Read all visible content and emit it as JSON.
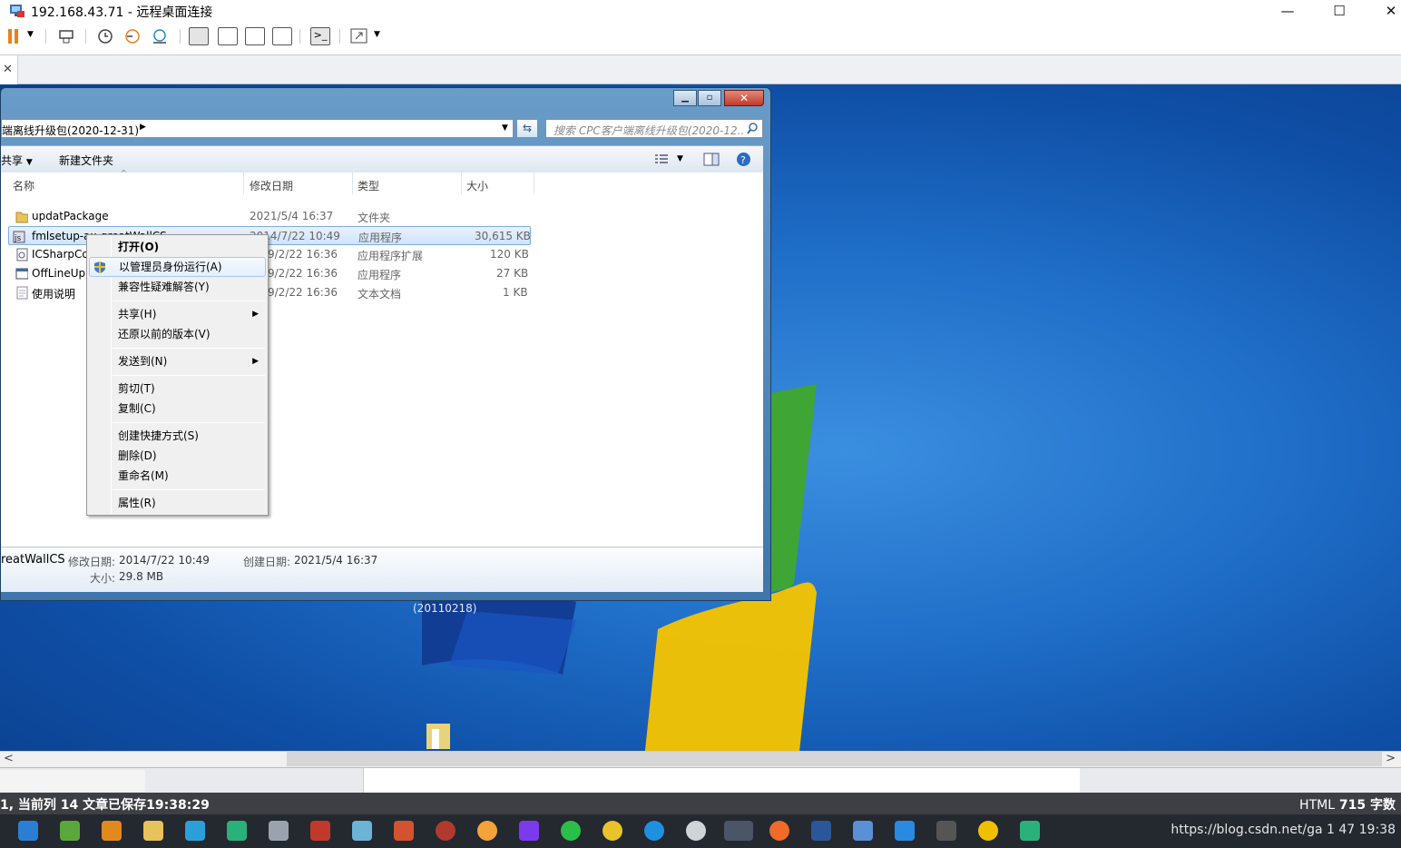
{
  "window": {
    "title": "192.168.43.71 - 远程桌面连接"
  },
  "explorer": {
    "address": "端离线升级包(2020-12-31)",
    "search_placeholder": "搜索 CPC客户端离线升级包(2020-12...",
    "cmd": {
      "share": "共享",
      "new_folder": "新建文件夹"
    },
    "columns": {
      "name": "名称",
      "modified": "修改日期",
      "type": "类型",
      "size": "大小"
    },
    "files": [
      {
        "name": "updatPackage",
        "modified": "2021/5/4 16:37",
        "type": "文件夹",
        "size": ""
      },
      {
        "name": "fmlsetup-ax-greatWallCS",
        "modified": "2014/7/22 10:49",
        "type": "应用程序",
        "size": "30,615 KB"
      },
      {
        "name": "ICSharpCo",
        "modified": "9/2/22 16:36",
        "type": "应用程序扩展",
        "size": "120 KB"
      },
      {
        "name": "OffLineUp",
        "modified": "9/2/22 16:36",
        "type": "应用程序",
        "size": "27 KB"
      },
      {
        "name": "使用说明",
        "modified": "9/2/22 16:36",
        "type": "文本文档",
        "size": "1 KB"
      }
    ],
    "details": {
      "name": "reatWallCS",
      "modified_label": "修改日期:",
      "modified": "2014/7/22 10:49",
      "created_label": "创建日期:",
      "created": "2021/5/4 16:37",
      "size_label": "大小:",
      "size": "29.8 MB"
    }
  },
  "context_menu": {
    "items": [
      "打开(O)",
      "以管理员身份运行(A)",
      "兼容性疑难解答(Y)",
      "共享(H)",
      "还原以前的版本(V)",
      "发送到(N)",
      "剪切(T)",
      "复制(C)",
      "创建快捷方式(S)",
      "删除(D)",
      "重命名(M)",
      "属性(R)"
    ]
  },
  "desktop": {
    "build_text": "(20110218)"
  },
  "status_bar": {
    "left": "1, 当前列 14  文章已保存19:38:29",
    "right_html": "HTML",
    "right_count": "715",
    "right_unit": "字数"
  },
  "taskbar": {
    "tray": "https://blog.csdn.net/ga  1  47 19:38"
  },
  "colors": {
    "desktop": "#1f6ec8",
    "taskbar": "#24282f",
    "status": "#3d3f44"
  }
}
